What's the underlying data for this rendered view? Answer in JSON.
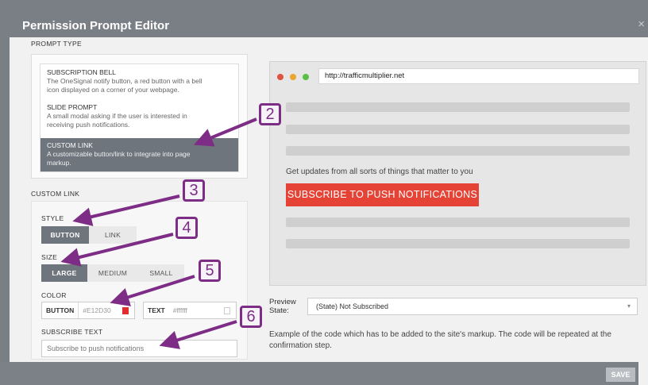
{
  "header": {
    "title": "Permission Prompt Editor",
    "close_glyph": "×"
  },
  "prompt_type": {
    "label": "PROMPT TYPE",
    "options": [
      {
        "title": "SUBSCRIPTION BELL",
        "desc1": "The OneSignal notify button, a red button with a bell",
        "desc2": "icon displayed on a corner of your webpage."
      },
      {
        "title": "SLIDE PROMPT",
        "desc1": "A small modal asking if the user is interested in",
        "desc2": "receiving push notifications."
      },
      {
        "title": "CUSTOM LINK",
        "desc1": "A customizable button/link to integrate into page",
        "desc2": "markup."
      }
    ],
    "selected_index": 2
  },
  "custom_link": {
    "label": "CUSTOM LINK",
    "style": {
      "label": "STYLE",
      "options": [
        "BUTTON",
        "LINK"
      ],
      "selected": "BUTTON"
    },
    "size": {
      "label": "SIZE",
      "options": [
        "LARGE",
        "MEDIUM",
        "SMALL"
      ],
      "selected": "LARGE"
    },
    "color": {
      "label": "COLOR",
      "button": {
        "key": "BUTTON",
        "value": "#E12D30",
        "swatch": "#e12d30"
      },
      "text": {
        "key": "TEXT",
        "value": "#ffffff",
        "swatch": "#ffffff"
      }
    },
    "subscribe_text": {
      "label": "SUBSCRIBE TEXT",
      "value": "Subscribe to push notifications"
    }
  },
  "preview": {
    "url": "http://trafficmultiplier.net",
    "message": "Get updates from all sorts of things that matter to you",
    "button_label": "SUBSCRIBE TO PUSH NOTIFICATIONS",
    "button_color": "#e54335",
    "dots": [
      "#e0533f",
      "#eaa530",
      "#5bbf45"
    ]
  },
  "preview_state": {
    "label1": "Preview",
    "label2": "State:",
    "value": "(State) Not Subscribed",
    "chevron": "▾"
  },
  "code_note": "Example of the code which has to be added to the site's markup. The code will be repeated at the confirmation step.",
  "footer": {
    "save_label": "SAVE"
  },
  "annotations": {
    "color": "#7d2d86",
    "badges": [
      "2",
      "3",
      "4",
      "5",
      "6"
    ]
  }
}
